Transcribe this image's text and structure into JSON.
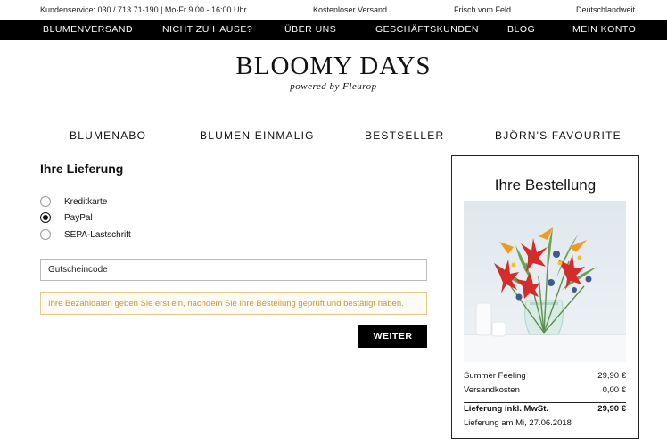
{
  "topbar": {
    "service": "Kundenservice: 030 / 713 71-190 | Mo-Fr 9:00 - 16:00 Uhr",
    "shipping": "Kostenloser Versand",
    "fresh": "Frisch vom Feld",
    "nationwide": "Deutschlandweit"
  },
  "nav": {
    "items": [
      "BLUMENVERSAND",
      "NICHT ZU HAUSE?",
      "ÜBER UNS",
      "GESCHÄFTSKUNDEN",
      "BLOG",
      "MEIN KONTO"
    ]
  },
  "logo": {
    "title": "BLOOMY DAYS",
    "subtitle": "powered by Fleurop"
  },
  "categories": [
    "BLUMENABO",
    "BLUMEN EINMALIG",
    "BESTSELLER",
    "BJÖRN'S FAVOURITE"
  ],
  "delivery": {
    "heading": "Ihre Lieferung",
    "payment_options": [
      {
        "label": "Kreditkarte",
        "selected": false
      },
      {
        "label": "PayPal",
        "selected": true
      },
      {
        "label": "SEPA-Lastschrift",
        "selected": false
      }
    ],
    "voucher_placeholder": "Gutscheincode",
    "notice": "Ihre Bezahldaten geben Sie erst ein, nachdem Sie Ihre Bestellung geprüft und bestätigt haben.",
    "submit_label": "WEITER"
  },
  "order": {
    "title": "Ihre Bestellung",
    "items": [
      {
        "name": "Summer Feeling",
        "price": "29,90 €"
      },
      {
        "name": "Versandkosten",
        "price": "0,00 €"
      }
    ],
    "total_label": "Lieferung inkl. MwSt.",
    "total_value": "29,90 €",
    "delivery_date": "Lieferung am Mi, 27.06.2018"
  },
  "colors": {
    "nav_bg": "#000000",
    "notice_border": "#e3c98a",
    "notice_text": "#c59a3c"
  }
}
